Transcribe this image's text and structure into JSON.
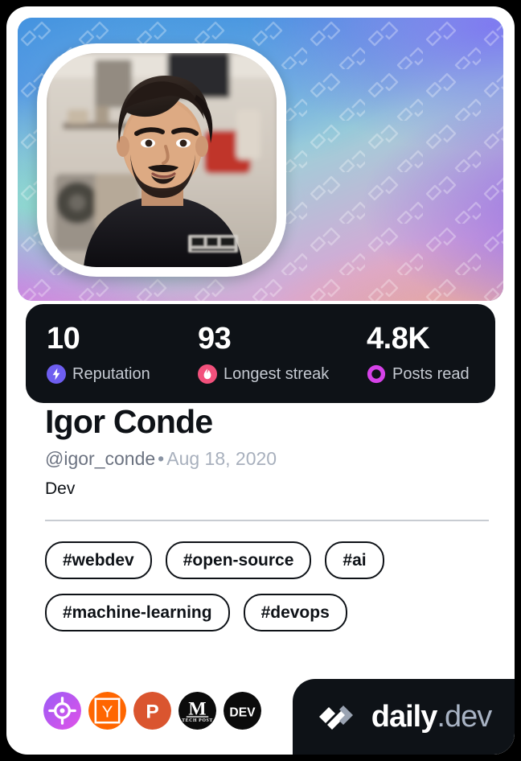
{
  "card": {
    "type": "devcard"
  },
  "cover": {
    "pattern_icon": "daily-dev-logo-watermark",
    "colors": [
      "#3f92dd",
      "#8fd9cf",
      "#ee77d8",
      "#8f6fe8",
      "#f0b08a"
    ]
  },
  "avatar": {
    "alt": "Igor Conde profile photo"
  },
  "stats": [
    {
      "value": "10",
      "label": "Reputation",
      "icon": "reputation-bolt-icon",
      "color": "#6e5ef0"
    },
    {
      "value": "93",
      "label": "Longest streak",
      "icon": "streak-flame-icon",
      "color": "#f2517c"
    },
    {
      "value": "4.8K",
      "label": "Posts read",
      "icon": "posts-read-ring-icon",
      "color": "#d642e8"
    }
  ],
  "profile": {
    "name": "Igor Conde",
    "handle": "@igor_conde",
    "separator": "•",
    "joined": "Aug 18, 2020",
    "bio": "Dev"
  },
  "tags": [
    "#webdev",
    "#open-source",
    "#ai",
    "#machine-learning",
    "#devops"
  ],
  "badges": [
    {
      "name": "target-badge",
      "label": "",
      "color": "#a855f7"
    },
    {
      "name": "hacker-news-badge",
      "label": "Y",
      "color": "#ff6600"
    },
    {
      "name": "product-hunt-badge",
      "label": "P",
      "color": "#da552f"
    },
    {
      "name": "tech-post-badge",
      "label": "M",
      "sublabel": "TECH POST",
      "color": "#0b0b0b"
    },
    {
      "name": "dev-to-badge",
      "label": "DEV",
      "color": "#0b0b0b"
    }
  ],
  "brand": {
    "name": "daily",
    "tld": ".dev",
    "mark": "daily-dev-logo-icon",
    "background": "#0e1217"
  }
}
